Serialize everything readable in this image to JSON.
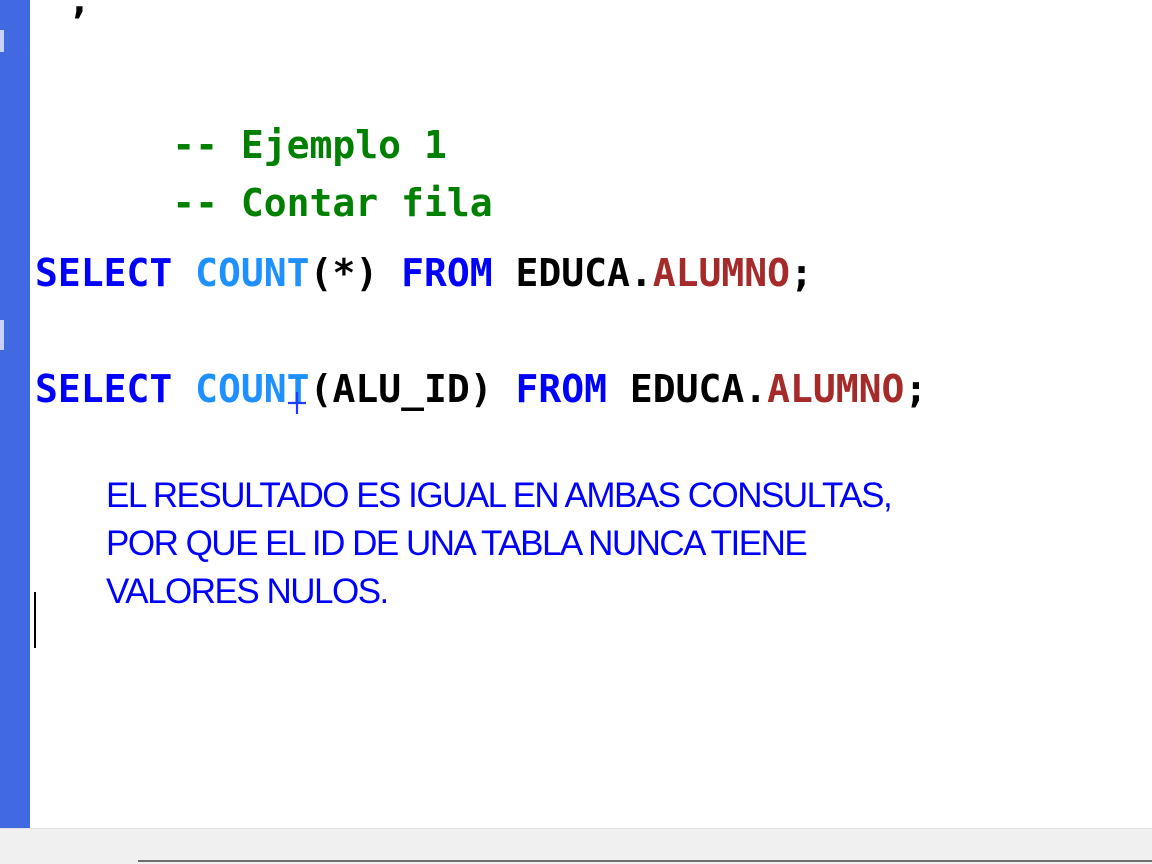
{
  "editor": {
    "partial_top_line": ";",
    "comment_1": "-- Ejemplo 1",
    "comment_2": "-- Contar fila",
    "query_1": {
      "keyword_select": "SELECT",
      "function": "COUNT",
      "argument": "(*)",
      "keyword_from": "FROM",
      "schema": "EDUCA.",
      "table": "ALUMNO",
      "terminator": ";"
    },
    "query_2": {
      "keyword_select": "SELECT",
      "function": "COUNT",
      "argument": "(ALU_ID)",
      "keyword_from": "FROM",
      "schema": "EDUCA.",
      "table": "ALUMNO",
      "terminator": ";"
    },
    "note_lines": [
      "EL RESULTADO ES IGUAL EN AMBAS CONSULTAS,",
      "POR QUE EL ID DE UNA TABLA NUNCA TIENE",
      "VALORES NULOS."
    ]
  },
  "colors": {
    "gutter": "#4169e1",
    "comment": "#008000",
    "keyword": "#0000ff",
    "function": "#1e90ff",
    "table": "#a52a2a",
    "note": "#0000ff"
  },
  "icons": {
    "mouse_cursor": "crosshair-cursor-icon"
  }
}
